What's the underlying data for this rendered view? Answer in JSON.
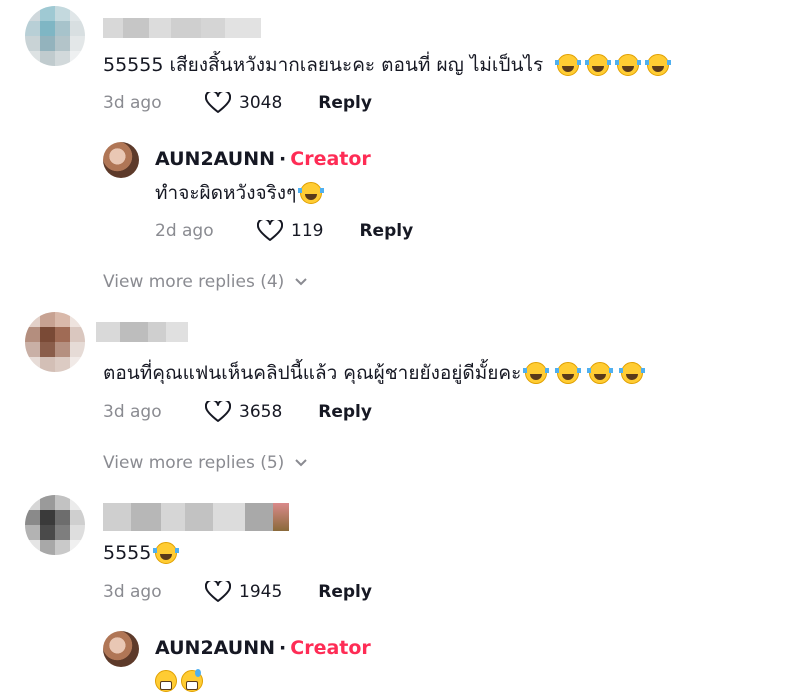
{
  "comments": [
    {
      "text": "55555 เสียงสิ้นหวังมากเลยนะคะ ตอนที่ ผญ ไม่เป็นไร",
      "emoji": [
        "tears-of-joy-icon",
        "tears-of-joy-icon",
        "tears-of-joy-icon",
        "tears-of-joy-icon"
      ],
      "time": "3d ago",
      "likes": "3048",
      "reply_label": "Reply",
      "replies": [
        {
          "author": "AUN2AUNN",
          "separator": "·",
          "badge": "Creator",
          "text": "ทำจะผิดหวังจริงๆ",
          "emoji": [
            "tears-of-joy-icon"
          ],
          "time": "2d ago",
          "likes": "119",
          "reply_label": "Reply"
        }
      ],
      "view_more": "View more replies (4)"
    },
    {
      "text": "ตอนที่คุณแฟนเห็นคลิปนี้แล้ว คุณผู้ชายยังอยู่ดีมั้ยคะ",
      "emoji": [
        "tears-of-joy-icon",
        "tears-of-joy-icon",
        "tears-of-joy-icon",
        "tears-of-joy-icon"
      ],
      "time": "3d ago",
      "likes": "3658",
      "reply_label": "Reply",
      "view_more": "View more replies (5)"
    },
    {
      "text": "5555",
      "emoji": [
        "tears-of-joy-icon"
      ],
      "time": "3d ago",
      "likes": "1945",
      "reply_label": "Reply",
      "replies": [
        {
          "author": "AUN2AUNN",
          "separator": "·",
          "badge": "Creator",
          "emoji": [
            "grinning-face-icon",
            "grinning-sweat-icon"
          ]
        }
      ]
    }
  ],
  "colors": {
    "creator_badge": "#fe2c55",
    "muted": "#8a8b91",
    "text": "#161823"
  }
}
